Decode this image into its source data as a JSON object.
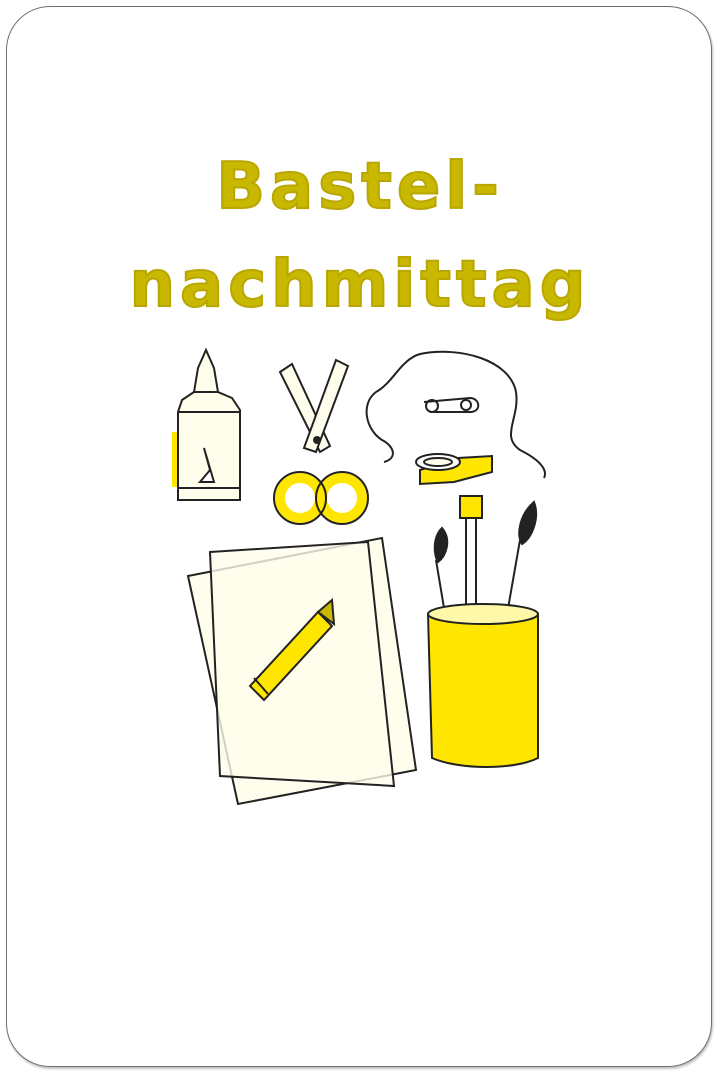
{
  "title": {
    "line1": "Bastel-",
    "line2": "nachmittag"
  },
  "colors": {
    "accent": "#ffe600",
    "title": "#c9b800",
    "paper": "#fffdeb",
    "ink": "#222222"
  },
  "illustration": {
    "items": [
      "glue-bottle-icon",
      "scissors-icon",
      "thread-icon",
      "safety-pin-icon",
      "tape-roll-icon",
      "paper-sheets-icon",
      "crayon-icon",
      "brush-cup-icon"
    ]
  }
}
